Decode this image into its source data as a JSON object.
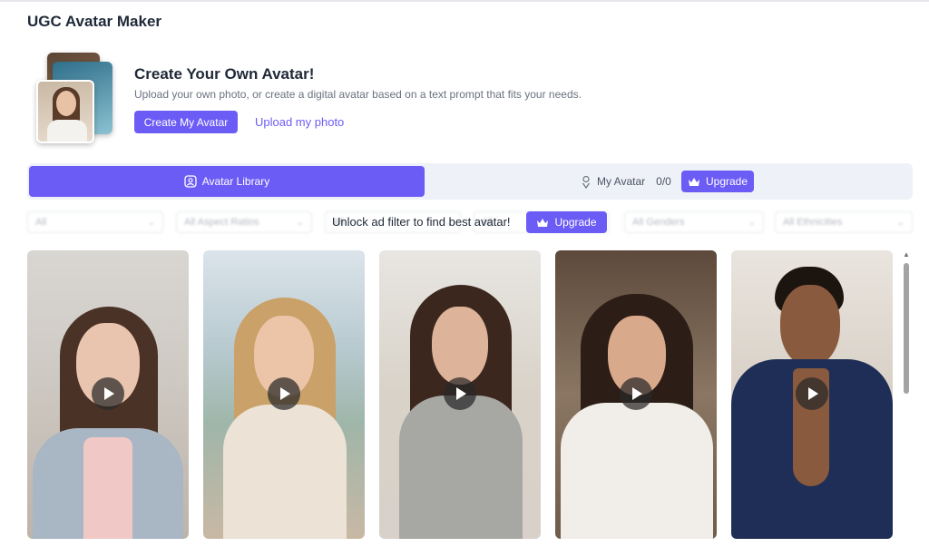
{
  "page": {
    "title": "UGC Avatar Maker"
  },
  "hero": {
    "title": "Create Your Own Avatar!",
    "subtitle": "Upload your own photo, or create a digital avatar based on a text prompt that fits your needs.",
    "create_button": "Create My Avatar",
    "upload_link": "Upload my photo"
  },
  "tabs": {
    "library": {
      "label": "Avatar Library",
      "icon": "avatar-portrait-icon"
    },
    "my_avatar": {
      "label": "My Avatar",
      "count": "0/0",
      "icon": "avatar-pin-icon"
    },
    "upgrade": {
      "label": "Upgrade",
      "icon": "crown-icon"
    }
  },
  "filters": {
    "items": [
      {
        "value": "All"
      },
      {
        "value": "All Aspect Ratios"
      },
      {
        "value": "All"
      },
      {
        "value": "All"
      },
      {
        "value": "All Genders"
      },
      {
        "value": "All Ethnicities"
      }
    ],
    "unlock_text": "Unlock ad filter to find best avatar!",
    "upgrade_label": "Upgrade"
  },
  "avatars": [
    {
      "name": "avatar-woman-office",
      "play_icon": "play-icon"
    },
    {
      "name": "avatar-woman-pool",
      "play_icon": "play-icon"
    },
    {
      "name": "avatar-woman-bedroom",
      "play_icon": "play-icon"
    },
    {
      "name": "avatar-woman-study",
      "play_icon": "play-icon"
    },
    {
      "name": "avatar-man-robe",
      "play_icon": "play-icon"
    }
  ],
  "colors": {
    "accent": "#6c5cf6",
    "tab_bg": "#eef1f8",
    "title": "#1f2937"
  }
}
